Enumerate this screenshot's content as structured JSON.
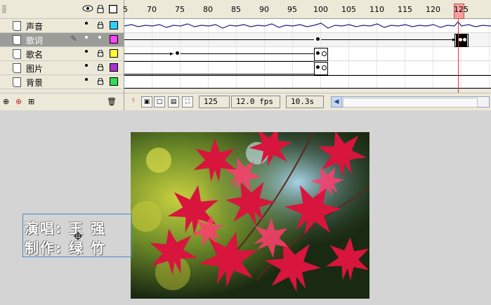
{
  "timeline": {
    "ruler_labels": [
      "5",
      "70",
      "75",
      "80",
      "85",
      "90",
      "95",
      "100",
      "105",
      "110",
      "115",
      "120",
      "125"
    ],
    "layers": [
      {
        "name": "声音",
        "color": "#33ccff",
        "selected": false
      },
      {
        "name": "歌词",
        "color": "#ff44ff",
        "selected": true
      },
      {
        "name": "歌名",
        "color": "#ffff33",
        "selected": false
      },
      {
        "name": "图片",
        "color": "#aa33cc",
        "selected": false
      },
      {
        "name": "背景",
        "color": "#33dd55",
        "selected": false
      }
    ],
    "current_frame": "125",
    "fps": "12.0 fps",
    "elapsed": "10.3s"
  },
  "stage": {
    "text_line1": "演唱: 王 强",
    "text_line2": "制作: 绿 竹"
  },
  "icons": [
    "eye-icon",
    "lock-icon",
    "outline-icon",
    "pencil-icon",
    "add-layer-icon",
    "add-guide-icon",
    "add-folder-icon",
    "trash-icon",
    "center-frame-icon",
    "onion-skin-icon",
    "onion-outline-icon",
    "edit-multiple-icon",
    "onion-markers-icon"
  ]
}
